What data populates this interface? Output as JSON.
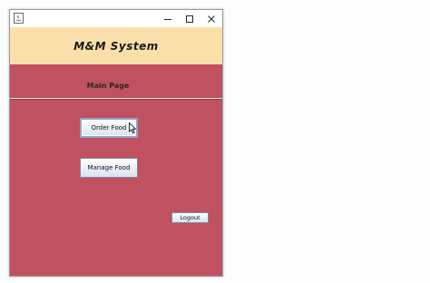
{
  "window": {
    "title": "",
    "controls": {
      "minimize_icon": "minimize-icon",
      "maximize_icon": "maximize-icon",
      "close_icon": "close-icon"
    }
  },
  "banner": {
    "title": "M&M System",
    "background": "#fbdfaa"
  },
  "main": {
    "subtitle": "Main Page",
    "background": "#c05160",
    "buttons": {
      "order_food": "Order Food",
      "manage_food": "Manage Food",
      "logout": "Logout"
    }
  }
}
